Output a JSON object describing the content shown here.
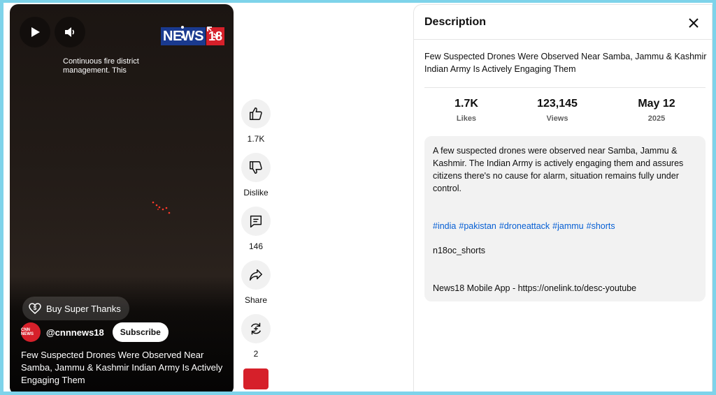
{
  "player": {
    "overlay_text": "Continuous fire district management. This",
    "logo": {
      "word": "NEWS",
      "num": "18"
    },
    "super_thanks": "Buy Super Thanks",
    "channel": {
      "handle": "@cnnnews18",
      "avatar_text": "CNN NEWS",
      "subscribe_label": "Subscribe"
    },
    "title": "Few Suspected Drones Were Observed Near Samba, Jammu & Kashmir Indian Army Is Actively Engaging Them"
  },
  "rail": {
    "like_count": "1.7K",
    "dislike_label": "Dislike",
    "comment_count": "146",
    "share_label": "Share",
    "remix_count": "2"
  },
  "panel": {
    "header": "Description",
    "title": "Few Suspected Drones Were Observed Near Samba, Jammu & Kashmir Indian Army Is Actively Engaging Them",
    "stats": [
      {
        "value": "1.7K",
        "label": "Likes"
      },
      {
        "value": "123,145",
        "label": "Views"
      },
      {
        "value": "May 12",
        "label": "2025"
      }
    ],
    "body": "A few suspected drones were observed near Samba, Jammu & Kashmir. The Indian Army is actively engaging them and assures citizens there's no cause for alarm, situation remains fully under control.",
    "hashtags": [
      "#india",
      "#pakistan",
      "#droneattack",
      "#jammu",
      "#shorts"
    ],
    "code": "n18oc_shorts",
    "app_line": "News18 Mobile App - https://onelink.to/desc-youtube"
  },
  "colors": {
    "accent_link": "#065fd4",
    "brand_red": "#d6202a",
    "page_border": "#7ed3ea"
  },
  "icons": [
    "play-icon",
    "volume-icon",
    "more-icon",
    "fullscreen-icon",
    "like-icon",
    "dislike-icon",
    "comment-icon",
    "share-icon",
    "remix-icon",
    "close-icon",
    "super-thanks-icon"
  ]
}
